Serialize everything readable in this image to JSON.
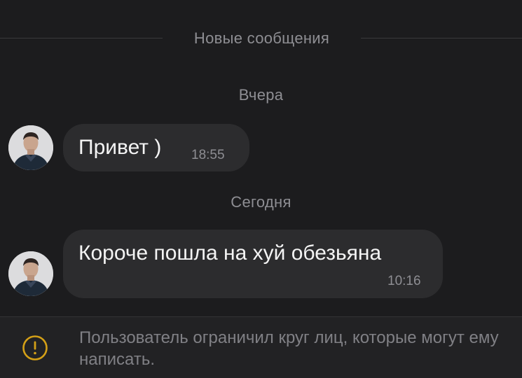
{
  "divider": {
    "label": "Новые сообщения"
  },
  "messages": [
    {
      "date_label": "Вчера",
      "text": "Привет )",
      "time": "18:55"
    },
    {
      "date_label": "Сегодня",
      "text": "Короче пошла на хуй обезьяна",
      "time": "10:16"
    }
  ],
  "notice": {
    "icon": "warning-icon",
    "text": "Пользователь ограничил круг лиц, которые могут ему написать."
  },
  "colors": {
    "background": "#1c1c1e",
    "bubble": "#2c2c2e",
    "secondary_text": "#8e8e93",
    "warning": "#d4a017"
  }
}
